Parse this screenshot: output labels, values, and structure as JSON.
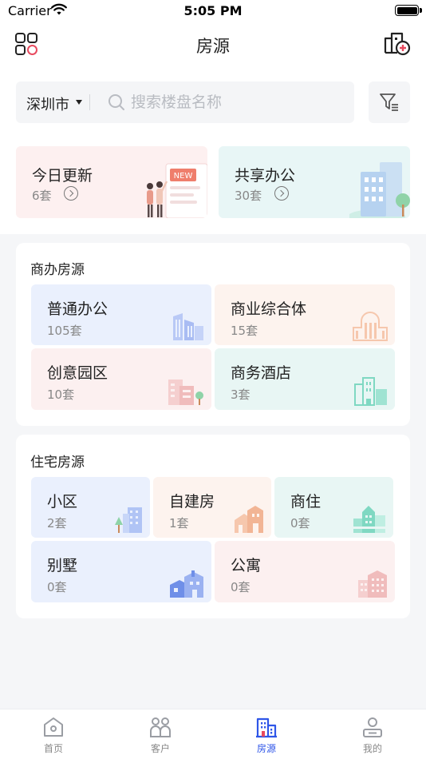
{
  "status_bar": {
    "carrier": "Carrier",
    "time": "5:05 PM"
  },
  "nav": {
    "title": "房源",
    "left_icon": "apps-grid-icon",
    "right_icon": "add-property-icon"
  },
  "search": {
    "city": "深圳市",
    "placeholder": "搜索楼盘名称",
    "value": ""
  },
  "promos": [
    {
      "title": "今日更新",
      "count": "6套"
    },
    {
      "title": "共享办公",
      "count": "30套"
    }
  ],
  "commercial": {
    "title": "商办房源",
    "items": [
      {
        "name": "普通办公",
        "count": "105套"
      },
      {
        "name": "商业综合体",
        "count": "15套"
      },
      {
        "name": "创意园区",
        "count": "10套"
      },
      {
        "name": "商务酒店",
        "count": "3套"
      }
    ]
  },
  "residential": {
    "title": "住宅房源",
    "items": [
      {
        "name": "小区",
        "count": "2套"
      },
      {
        "name": "自建房",
        "count": "1套"
      },
      {
        "name": "商住",
        "count": "0套"
      },
      {
        "name": "别墅",
        "count": "0套"
      },
      {
        "name": "公寓",
        "count": "0套"
      }
    ]
  },
  "tabs": [
    {
      "label": "首页",
      "icon": "home-icon"
    },
    {
      "label": "客户",
      "icon": "clients-icon"
    },
    {
      "label": "房源",
      "icon": "building-icon",
      "active": true
    },
    {
      "label": "我的",
      "icon": "profile-icon"
    }
  ],
  "colors": {
    "accent": "#2f56e8",
    "active_icon_detail": "#e84a5f"
  }
}
